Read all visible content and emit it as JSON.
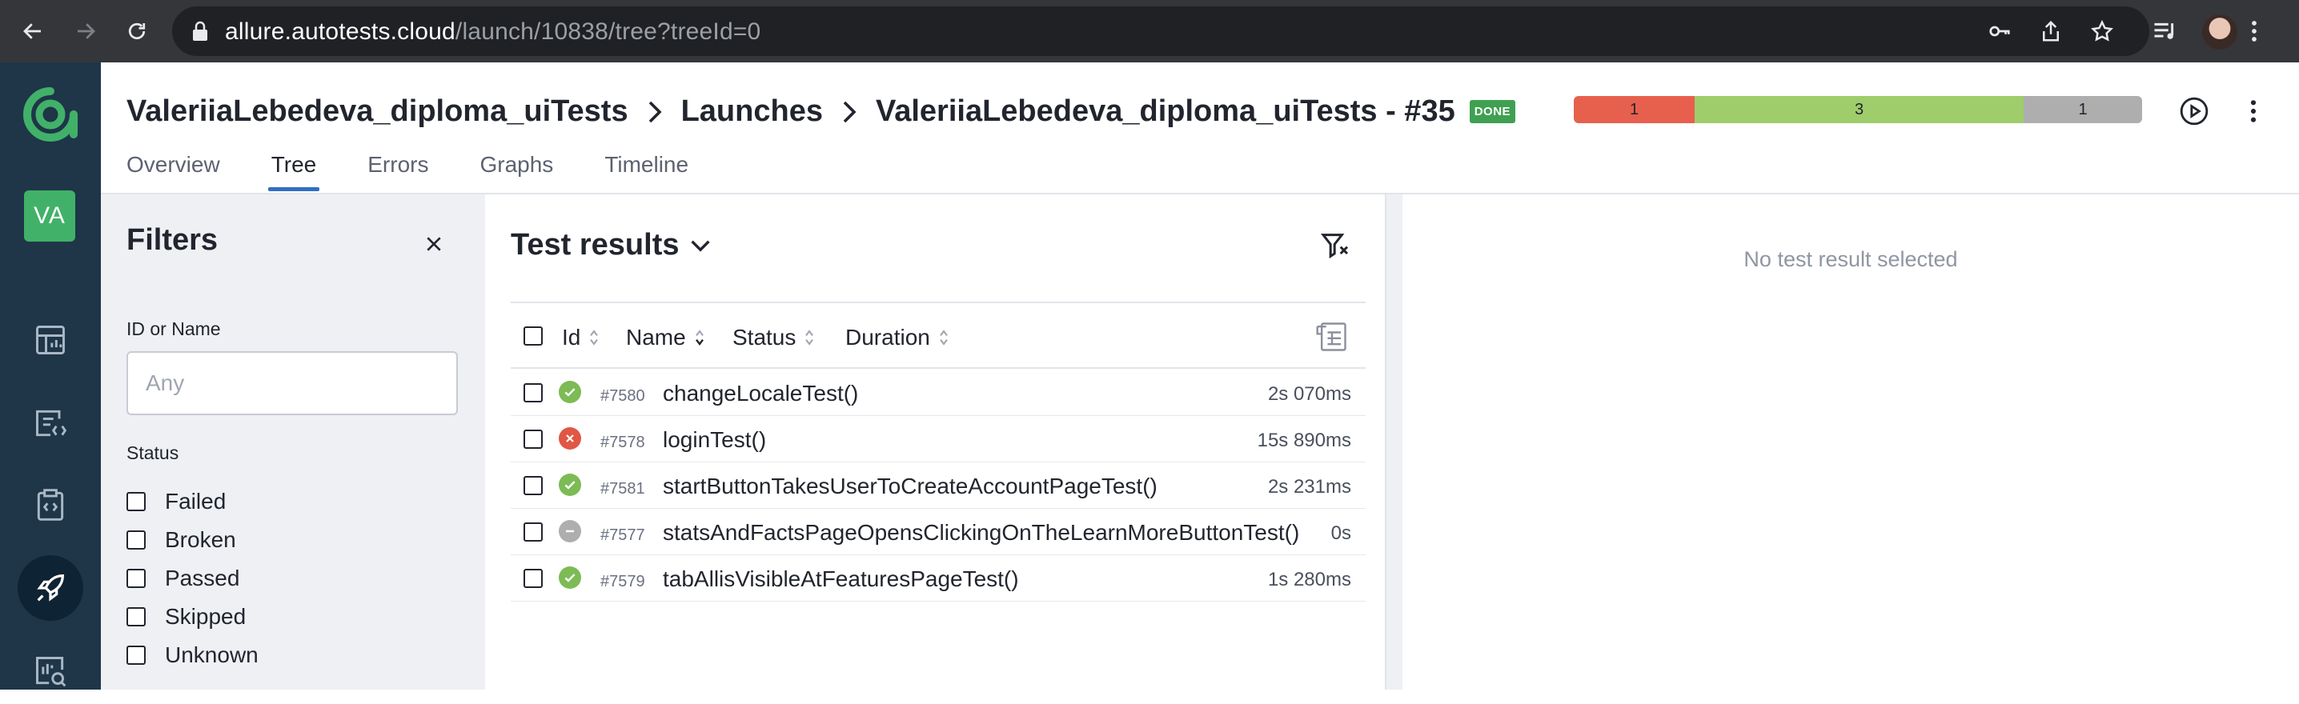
{
  "browser": {
    "url_host": "allure.autotests.cloud",
    "url_path": "/launch/10838/tree?treeId=0"
  },
  "rail": {
    "avatar_initials": "VA",
    "items": [
      "dashboards-icon",
      "launches-icon",
      "test-cases-icon",
      "launches-active-icon",
      "analytics-icon"
    ]
  },
  "header": {
    "breadcrumb": {
      "project": "ValeriiaLebedeva_diploma_uiTests",
      "section": "Launches",
      "launch": "ValeriiaLebedeva_diploma_uiTests - #35"
    },
    "status_badge": "DONE",
    "stats": {
      "failed": "1",
      "passed": "3",
      "skipped": "1",
      "colors": {
        "failed": "#e7604e",
        "passed": "#9fcd6c",
        "skipped": "#aeaeae"
      }
    },
    "tabs": [
      {
        "label": "Overview",
        "active": false
      },
      {
        "label": "Tree",
        "active": true
      },
      {
        "label": "Errors",
        "active": false
      },
      {
        "label": "Graphs",
        "active": false
      },
      {
        "label": "Timeline",
        "active": false
      }
    ]
  },
  "filters": {
    "title": "Filters",
    "id_name_label": "ID or Name",
    "id_name_placeholder": "Any",
    "status_label": "Status",
    "statuses": [
      "Failed",
      "Broken",
      "Passed",
      "Skipped",
      "Unknown"
    ]
  },
  "results": {
    "title": "Test results",
    "columns": {
      "id": "Id",
      "name": "Name",
      "status": "Status",
      "duration": "Duration"
    },
    "rows": [
      {
        "id": "#7580",
        "name": "changeLocaleTest()",
        "duration": "2s 070ms",
        "status": "passed"
      },
      {
        "id": "#7578",
        "name": "loginTest()",
        "duration": "15s 890ms",
        "status": "failed"
      },
      {
        "id": "#7581",
        "name": "startButtonTakesUserToCreateAccountPageTest()",
        "duration": "2s 231ms",
        "status": "passed"
      },
      {
        "id": "#7577",
        "name": "statsAndFactsPageOpensClickingOnTheLearnMoreButtonTest()",
        "duration": "0s",
        "status": "skipped"
      },
      {
        "id": "#7579",
        "name": "tabAllisVisibleAtFeaturesPageTest()",
        "duration": "1s 280ms",
        "status": "passed"
      }
    ]
  },
  "detail": {
    "empty_message": "No test result selected"
  }
}
